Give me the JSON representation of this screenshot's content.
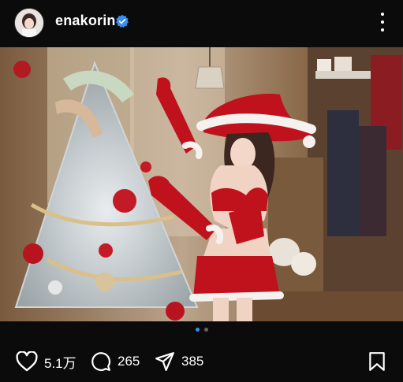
{
  "post": {
    "username": "enakorin",
    "verified": true,
    "likes": "5.1万",
    "comments": "265",
    "shares": "385",
    "carousel": {
      "count": 2,
      "active": 1
    }
  },
  "icons": {
    "avatar": "avatar",
    "verified": "verified-badge-icon",
    "more": "more-options-icon",
    "like": "heart-icon",
    "comment": "comment-bubble-icon",
    "share": "send-icon",
    "save": "bookmark-icon"
  },
  "colors": {
    "background": "#0b0b0b",
    "verified": "#3b8eed",
    "carousel_active": "#3b8eed"
  }
}
